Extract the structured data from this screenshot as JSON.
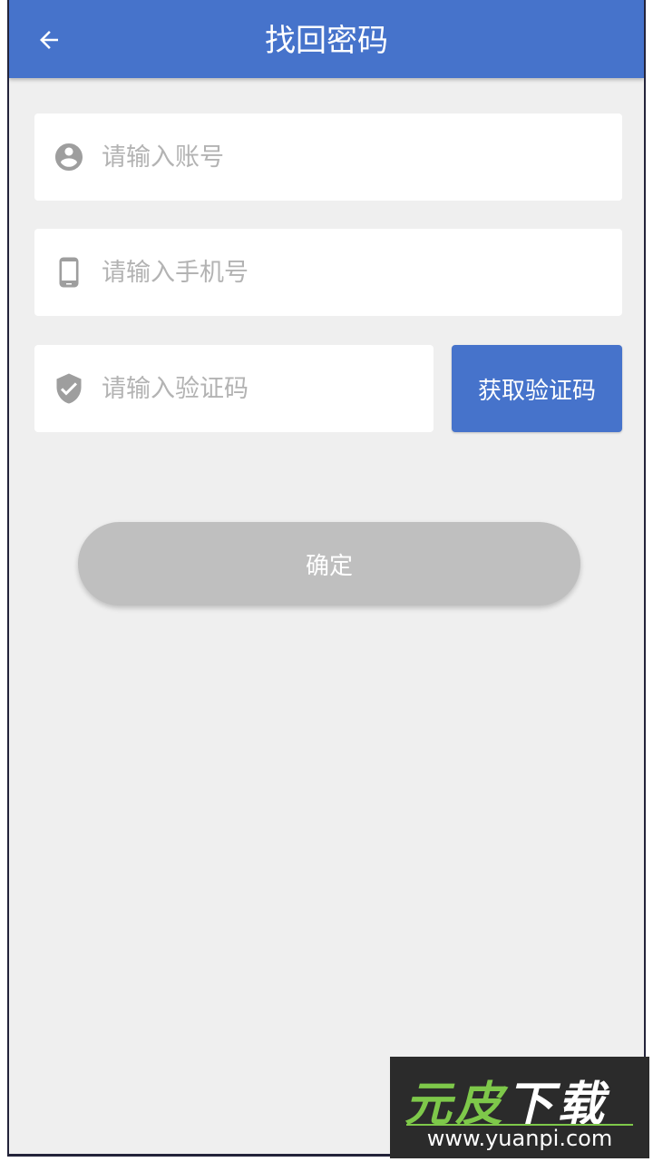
{
  "header": {
    "title": "找回密码",
    "back_icon": "arrow-left-icon",
    "background_color": "#4673cb"
  },
  "form": {
    "account": {
      "icon": "user-circle-icon",
      "placeholder": "请输入账号",
      "value": ""
    },
    "phone": {
      "icon": "smartphone-icon",
      "placeholder": "请输入手机号",
      "value": ""
    },
    "code": {
      "icon": "shield-check-icon",
      "placeholder": "请输入验证码",
      "value": ""
    },
    "get_code_label": "获取验证码",
    "confirm_label": "确定"
  },
  "watermark": {
    "brand_part1": "元皮",
    "brand_part2": "下载",
    "url": "www.yuanpi.com"
  },
  "colors": {
    "accent": "#4673cb",
    "disabled_button": "#bfbfbf",
    "page_background": "#efefef",
    "icon_gray": "#9e9e9e",
    "placeholder": "#b3b3b3"
  }
}
